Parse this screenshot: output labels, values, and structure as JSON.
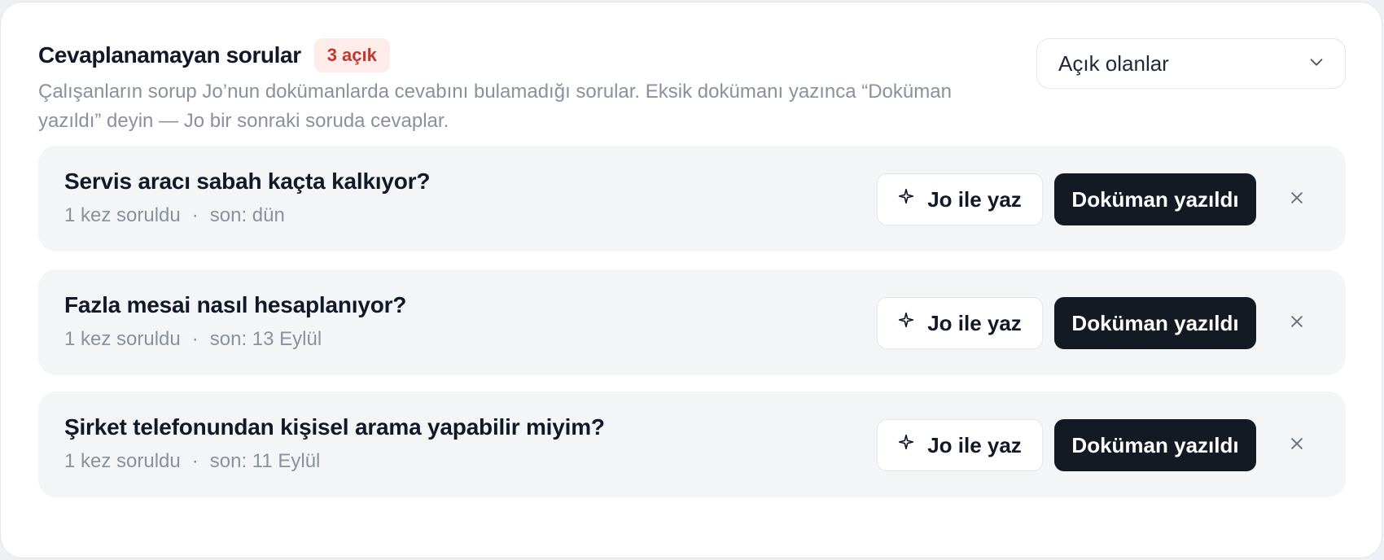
{
  "header": {
    "title": "Cevaplanamayan sorular",
    "badge": "3 açık",
    "subtitle": "Çalışanların sorup Jo’nun dokümanlarda cevabını bulamadığı sorular. Eksik dokümanı yazınca “Doküman yazıldı” deyin — Jo bir sonraki soruda cevaplar."
  },
  "filter": {
    "value": "Açık olanlar",
    "icon": "chevron-down-icon"
  },
  "actions": {
    "ai_write_label": "Jo ile yaz",
    "ai_write_icon": "sparkle-icon",
    "done_label": "Doküman yazıldı",
    "dismiss_icon": "close-icon"
  },
  "colors": {
    "badge_bg": "#fdecea",
    "badge_text": "#c0392b",
    "primary_button": "#141a24",
    "row_bg": "#f4f5f7"
  },
  "questions": [
    {
      "text": "Servis aracı sabah kaçta kalkıyor?",
      "count": "1 kez soruldu",
      "separator": "·",
      "last": "son: dün"
    },
    {
      "text": "Fazla mesai nasıl hesaplanıyor?",
      "count": "1 kez soruldu",
      "separator": "·",
      "last": "son: 13 Eylül"
    },
    {
      "text": "Şirket telefonundan kişisel arama yapabilir miyim?",
      "count": "1 kez soruldu",
      "separator": "·",
      "last": "son: 11 Eylül"
    }
  ]
}
